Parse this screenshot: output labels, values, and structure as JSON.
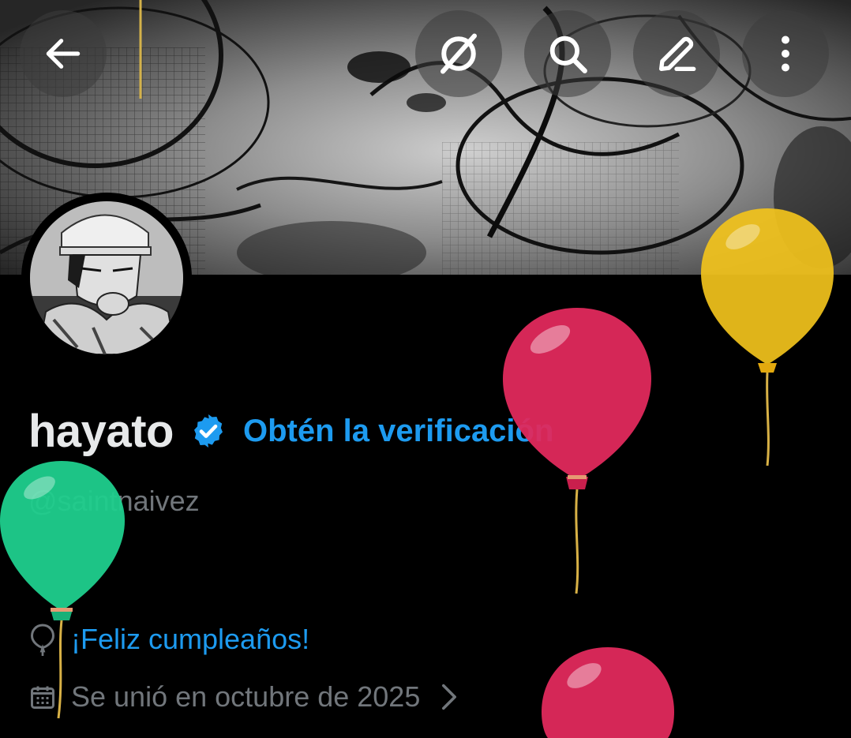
{
  "header": {
    "back_icon": "arrow-left-icon",
    "actions": [
      "grok-icon",
      "search-icon",
      "edit-icon",
      "more-vertical-icon"
    ]
  },
  "profile": {
    "name": "hayato",
    "verify_cta": "Obtén la verificación",
    "handle": "@saintnaivez",
    "birthday_text": "¡Feliz cumpleaños!",
    "joined_text": "Se unió en octubre de 2025"
  },
  "colors": {
    "accent": "#1d9bf0",
    "text_primary": "#e7e9ea",
    "text_secondary": "#71767b",
    "balloon_red": "#e0295c",
    "balloon_yellow": "#f2c31c",
    "balloon_green": "#1fcf8d"
  }
}
